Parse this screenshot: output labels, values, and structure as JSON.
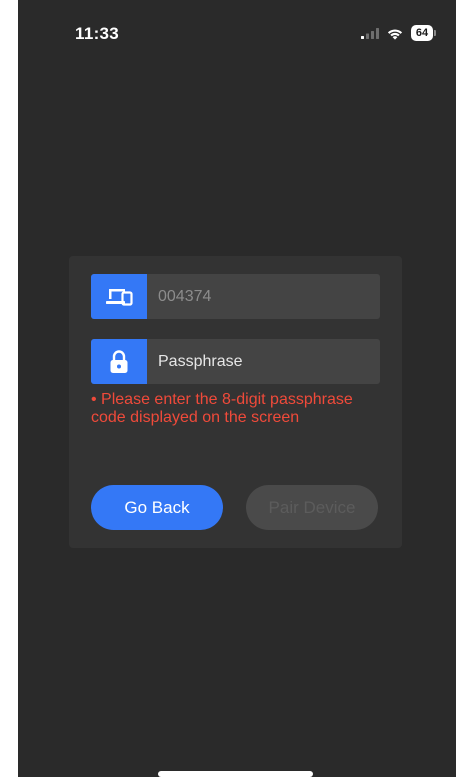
{
  "status_bar": {
    "time": "11:33",
    "battery_level": "64",
    "icons": [
      "signal-icon",
      "wifi-icon",
      "battery-icon"
    ]
  },
  "pairing_form": {
    "device_code": {
      "value": "004374",
      "icon": "device-icon"
    },
    "passphrase": {
      "value": "",
      "placeholder": "Passphrase",
      "icon": "lock-icon"
    },
    "error_message": "• Please enter the 8-digit passphrase code displayed on the screen",
    "buttons": {
      "go_back_label": "Go Back",
      "pair_device_label": "Pair Device",
      "pair_device_enabled": false
    }
  },
  "colors": {
    "background": "#2a2a2a",
    "card": "#333333",
    "field": "#444444",
    "accent": "#3478f6",
    "error": "#f04a3a",
    "disabled_button": "#4a4a4a"
  }
}
